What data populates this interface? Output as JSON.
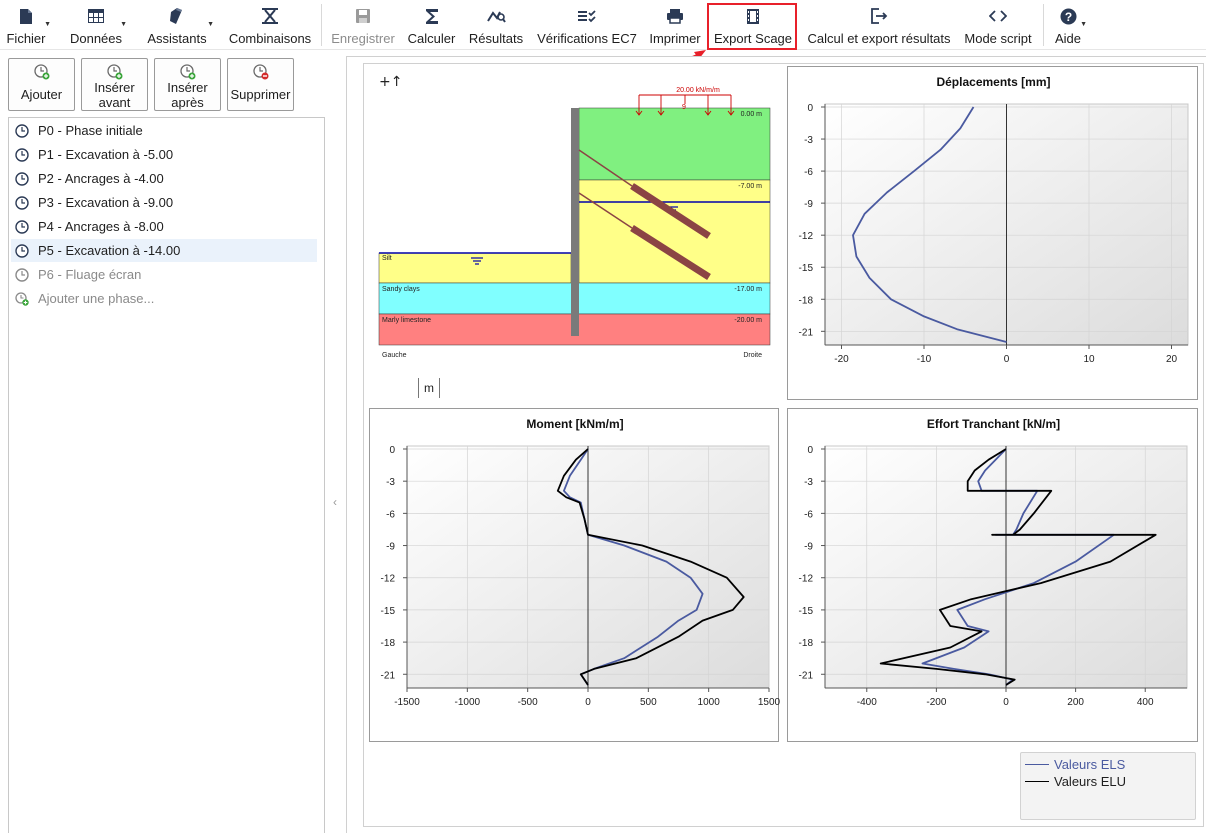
{
  "toolbar": {
    "items": [
      {
        "label": "Fichier",
        "icon": "file-icon",
        "dropdown": true
      },
      {
        "label": "Données",
        "icon": "table-icon",
        "dropdown": true
      },
      {
        "label": "Assistants",
        "icon": "wizard-icon",
        "dropdown": true
      },
      {
        "label": "Combinaisons",
        "icon": "combination-icon",
        "dropdown": false
      },
      {
        "label": "Enregistrer",
        "icon": "save-icon",
        "disabled": true
      },
      {
        "label": "Calculer",
        "icon": "sigma-icon"
      },
      {
        "label": "Résultats",
        "icon": "results-icon"
      },
      {
        "label": "Vérifications EC7",
        "icon": "checklist-icon"
      },
      {
        "label": "Imprimer",
        "icon": "printer-icon"
      },
      {
        "label": "Export Scage",
        "icon": "film-icon",
        "highlighted": true
      },
      {
        "label": "Calcul et export résultats",
        "icon": "export-icon"
      },
      {
        "label": "Mode script",
        "icon": "code-icon"
      },
      {
        "label": "Aide",
        "icon": "help-icon",
        "dropdown": true
      }
    ],
    "highlight_color": "#e8202a"
  },
  "phase_buttons": {
    "add": "Ajouter",
    "insert_before_1": "Insérer",
    "insert_before_2": "avant",
    "insert_after_1": "Insérer",
    "insert_after_2": "après",
    "delete": "Supprimer"
  },
  "phases": [
    {
      "label": "P0 - Phase initiale"
    },
    {
      "label": "P1 - Excavation à -5.00"
    },
    {
      "label": "P2 - Ancrages à -4.00"
    },
    {
      "label": "P3 - Excavation à -9.00"
    },
    {
      "label": "P4 - Ancrages à -8.00"
    },
    {
      "label": "P5 - Excavation à -14.00",
      "selected": true
    },
    {
      "label": "P6 - Fluage écran",
      "muted": true
    },
    {
      "label": "Ajouter une phase...",
      "muted": true
    }
  ],
  "diagram": {
    "load_label": "20.00 kN/m/m",
    "load_sub": "9",
    "levels": [
      "0.00 m",
      "-7.00 m",
      "-17.00 m",
      "-20.00 m"
    ],
    "layers": [
      "Silt",
      "Sandy clays",
      "Marly limestone"
    ],
    "left_label": "Gauche",
    "right_label": "Droite",
    "unit": "m",
    "axis_glyph": "+↑",
    "colors": {
      "green": "#80f080",
      "yellow": "#ffff88",
      "cyan": "#80ffff",
      "red": "#ff8080",
      "wall": "#7a7a7a",
      "anchor": "#8b4444",
      "water": "#0000aa"
    }
  },
  "legend": {
    "els": "Valeurs ELS",
    "elu": "Valeurs ELU",
    "els_color": "#4a5aa0",
    "elu_color": "#000000"
  },
  "chart_data": [
    {
      "type": "line",
      "title": "Déplacements [mm]",
      "xlim": [
        -22,
        22
      ],
      "ylim": [
        -22,
        0
      ],
      "xticks": [
        -20,
        -10,
        0,
        10,
        20
      ],
      "yticks": [
        0,
        -3,
        -6,
        -9,
        -12,
        -15,
        -18,
        -21
      ],
      "series": [
        {
          "name": "Valeurs ELS",
          "points": [
            [
              -4,
              0
            ],
            [
              -5.6,
              -2
            ],
            [
              -8,
              -4
            ],
            [
              -11.2,
              -6
            ],
            [
              -14.5,
              -8
            ],
            [
              -17.2,
              -10
            ],
            [
              -18.6,
              -12
            ],
            [
              -18.2,
              -14
            ],
            [
              -16.6,
              -16
            ],
            [
              -14,
              -18
            ],
            [
              -10,
              -19.6
            ],
            [
              -6,
              -20.8
            ],
            [
              0,
              -22
            ]
          ]
        }
      ]
    },
    {
      "type": "line",
      "title": "Moment [kNm/m]",
      "xlim": [
        -1500,
        1500
      ],
      "ylim": [
        -22,
        0
      ],
      "xticks": [
        -1500,
        -1000,
        -500,
        0,
        500,
        1000,
        1500
      ],
      "yticks": [
        0,
        -3,
        -6,
        -9,
        -12,
        -15,
        -18,
        -21
      ],
      "series": [
        {
          "name": "Valeurs ELS",
          "points": [
            [
              0,
              0
            ],
            [
              -60,
              -1
            ],
            [
              -150,
              -2.5
            ],
            [
              -200,
              -3.9
            ],
            [
              -150,
              -4.5
            ],
            [
              -60,
              -5
            ],
            [
              -30,
              -6.5
            ],
            [
              0,
              -8
            ],
            [
              300,
              -9
            ],
            [
              650,
              -10.5
            ],
            [
              850,
              -12
            ],
            [
              950,
              -13.5
            ],
            [
              900,
              -15
            ],
            [
              750,
              -16
            ],
            [
              580,
              -17.5
            ],
            [
              300,
              -19.5
            ],
            [
              50,
              -20.5
            ],
            [
              -60,
              -21
            ],
            [
              0,
              -22
            ]
          ]
        },
        {
          "name": "Valeurs ELU",
          "points": [
            [
              0,
              0
            ],
            [
              -100,
              -1
            ],
            [
              -200,
              -2.5
            ],
            [
              -250,
              -3.9
            ],
            [
              -180,
              -4.5
            ],
            [
              -70,
              -5
            ],
            [
              -30,
              -6.5
            ],
            [
              0,
              -8
            ],
            [
              450,
              -9
            ],
            [
              850,
              -10.5
            ],
            [
              1150,
              -12
            ],
            [
              1290,
              -13.8
            ],
            [
              1200,
              -15
            ],
            [
              950,
              -16
            ],
            [
              750,
              -17.5
            ],
            [
              400,
              -19.5
            ],
            [
              50,
              -20.5
            ],
            [
              -60,
              -21
            ],
            [
              0,
              -22
            ]
          ]
        }
      ]
    },
    {
      "type": "line",
      "title": "Effort Tranchant [kN/m]",
      "xlim": [
        -520,
        520
      ],
      "ylim": [
        -22,
        0
      ],
      "xticks": [
        -400,
        -200,
        0,
        200,
        400
      ],
      "yticks": [
        0,
        -3,
        -6,
        -9,
        -12,
        -15,
        -18,
        -21
      ],
      "series": [
        {
          "name": "Valeurs ELS",
          "points": [
            [
              0,
              0
            ],
            [
              -30,
              -1
            ],
            [
              -60,
              -2
            ],
            [
              -80,
              -3
            ],
            [
              -70,
              -3.9
            ],
            [
              90,
              -3.9
            ],
            [
              50,
              -6
            ],
            [
              30,
              -7.5
            ],
            [
              20,
              -8
            ],
            [
              -30,
              -8
            ],
            [
              310,
              -8
            ],
            [
              200,
              -10.5
            ],
            [
              80,
              -12.5
            ],
            [
              -60,
              -14
            ],
            [
              -140,
              -15
            ],
            [
              -110,
              -16.5
            ],
            [
              -50,
              -17
            ],
            [
              -120,
              -18.5
            ],
            [
              -240,
              -20
            ],
            [
              -150,
              -20.5
            ],
            [
              -50,
              -21
            ],
            [
              20,
              -21.5
            ],
            [
              0,
              -22
            ]
          ]
        },
        {
          "name": "Valeurs ELU",
          "points": [
            [
              0,
              0
            ],
            [
              -50,
              -1
            ],
            [
              -90,
              -2
            ],
            [
              -110,
              -3
            ],
            [
              -110,
              -3.9
            ],
            [
              130,
              -3.9
            ],
            [
              80,
              -6
            ],
            [
              40,
              -7.5
            ],
            [
              20,
              -8
            ],
            [
              -40,
              -8
            ],
            [
              430,
              -8
            ],
            [
              300,
              -10.5
            ],
            [
              100,
              -12.5
            ],
            [
              -100,
              -14
            ],
            [
              -190,
              -15
            ],
            [
              -160,
              -16.5
            ],
            [
              -70,
              -17
            ],
            [
              -160,
              -18.5
            ],
            [
              -360,
              -20
            ],
            [
              -200,
              -20.5
            ],
            [
              -60,
              -21
            ],
            [
              25,
              -21.5
            ],
            [
              0,
              -22
            ]
          ]
        }
      ]
    }
  ]
}
